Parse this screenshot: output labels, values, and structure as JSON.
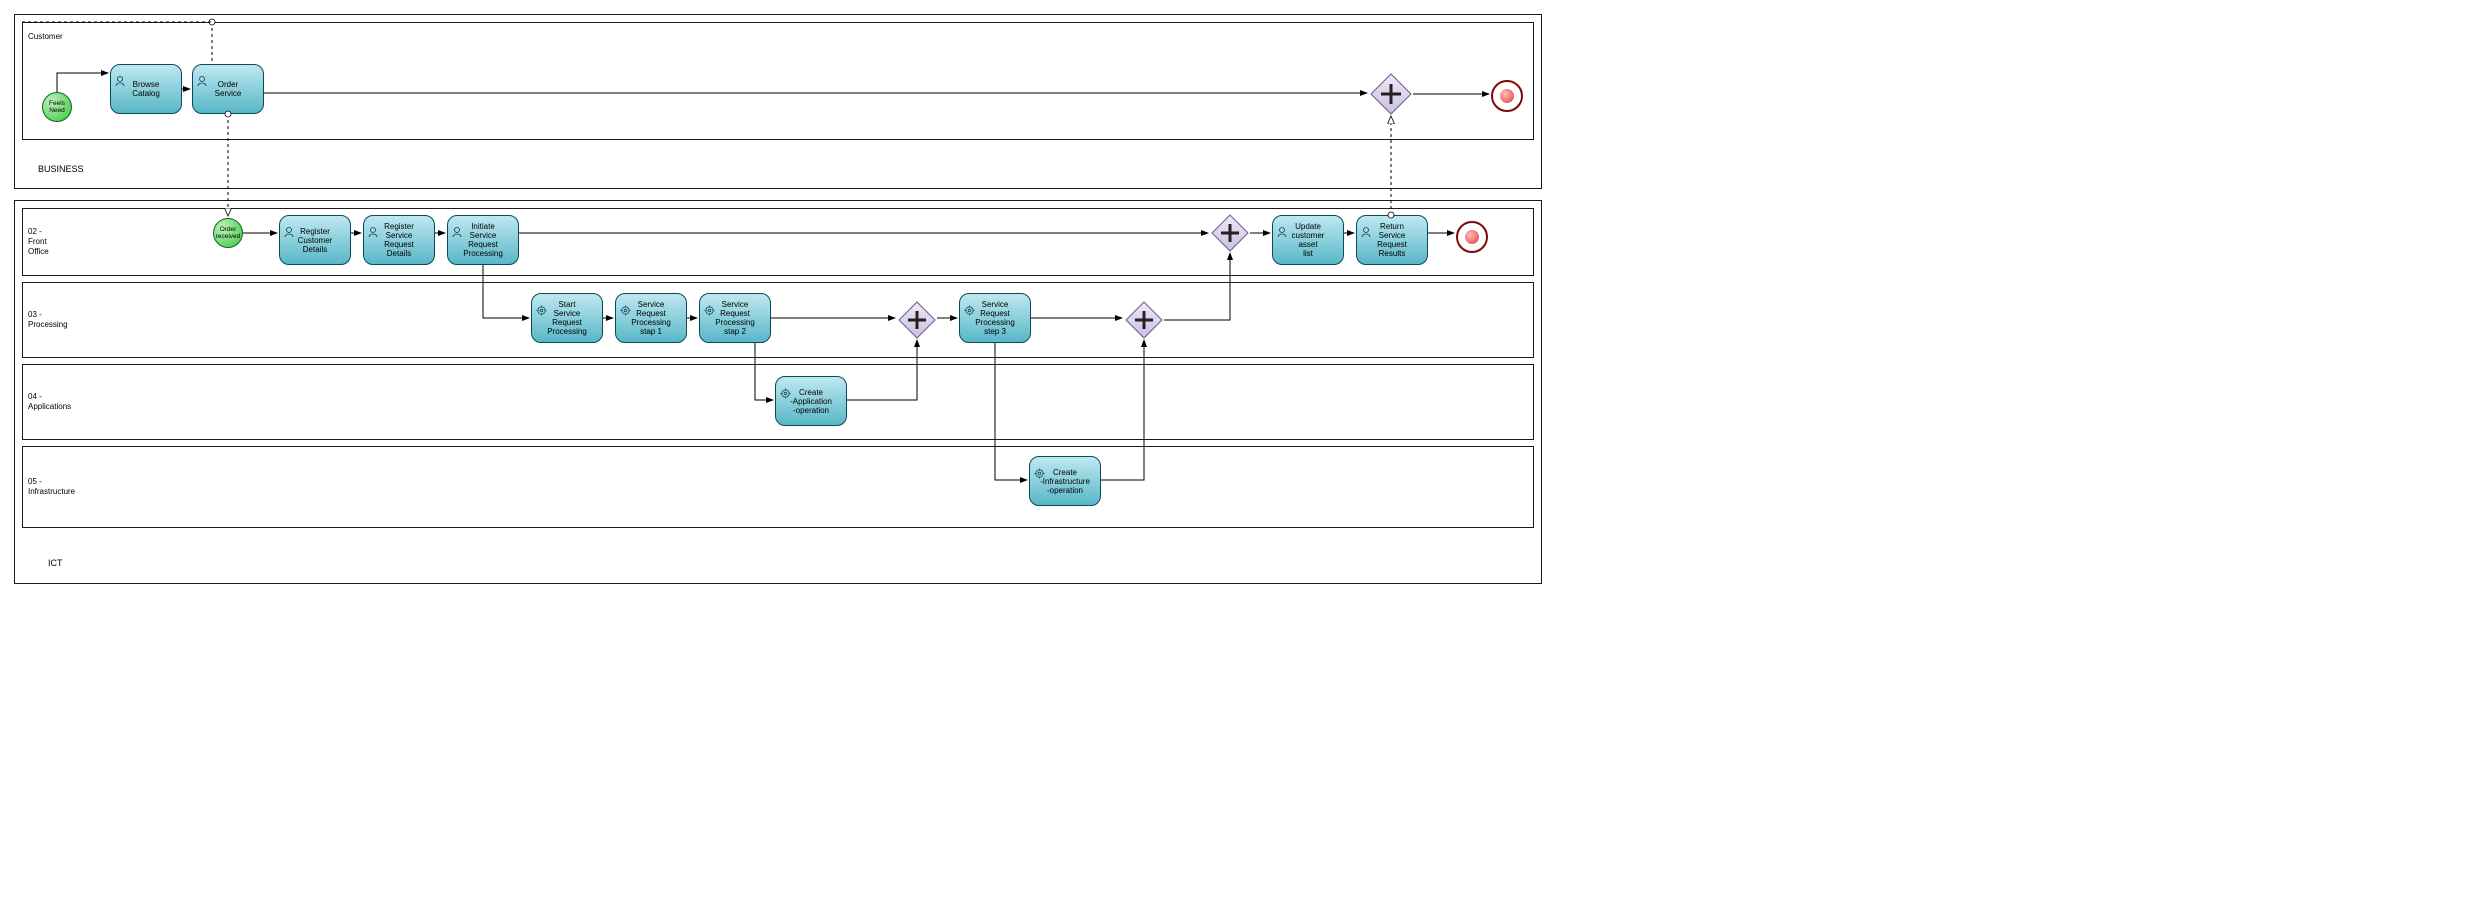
{
  "pools": {
    "business": {
      "label": "BUSINESS",
      "lane_customer": "Customer"
    },
    "ict": {
      "label": "ICT",
      "lane_front_office": "02 -\nFront\nOffice",
      "lane_processing": "03 -\nProcessing",
      "lane_applications": "04 -\nApplications",
      "lane_infrastructure": "05 -\nInfrastructure"
    }
  },
  "events": {
    "feels_need": "Feels\nNeed",
    "order_received": "Order\nreceived"
  },
  "tasks": {
    "browse_catalog": "Browse\nCatalog",
    "order_service": "Order\nService",
    "register_customer_details": "Register\nCustomer\nDetails",
    "register_service_request_details": "Register\nService\nRequest\nDetails",
    "initiate_service_request_processing": "Initiate\nService\nRequest\nProcessing",
    "update_customer_asset_list": "Update\ncustomer\nasset\nlist",
    "return_service_request_results": "Return\nService\nRequest\nResults",
    "start_service_request_processing": "Start\nService\nRequest\nProcessing",
    "service_request_processing_step1": "Service\nRequest\nProcessing\nstap 1",
    "service_request_processing_step2": "Service\nRequest\nProcessing\nstap 2",
    "service_request_processing_step3": "Service\nRequest\nProcessing\nstep 3",
    "create_application_operation": "Create\n-Application\n-operation",
    "create_infrastructure_operation": "Create\n-Infrastructure\n-operation"
  },
  "markers": {
    "user": "user",
    "service": "service",
    "gateway_parallel": "+"
  }
}
